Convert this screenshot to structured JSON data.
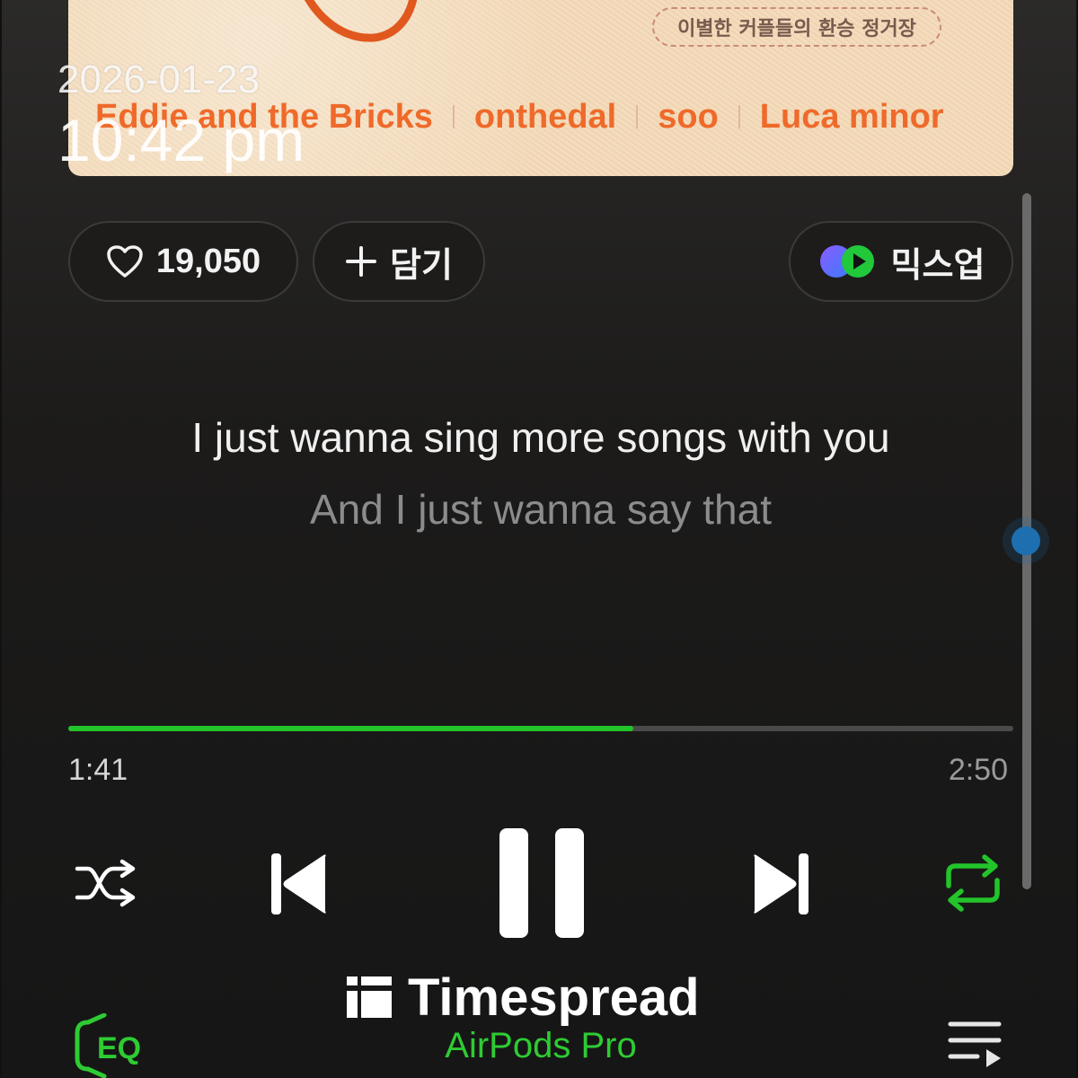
{
  "overlay": {
    "date": "2026-01-23",
    "time": "10:42 pm"
  },
  "album_art": {
    "badge_text": "이별한 커플들의 환승 정거장",
    "artists": [
      "Eddie and the Bricks",
      "onthedal",
      "soo",
      "Luca minor"
    ],
    "artist_color": "#ef6a2a"
  },
  "actions": {
    "like_count": "19,050",
    "add_label": "담기",
    "mixup_label": "믹스업"
  },
  "lyrics": {
    "current": "I just wanna sing more songs with you",
    "next": "And I just wanna say that"
  },
  "playback": {
    "elapsed": "1:41",
    "total": "2:50",
    "progress_fraction": 0.598,
    "accent_color": "#22c42a",
    "repeat_active": true
  },
  "controls": {
    "icons": [
      "shuffle-icon",
      "previous-icon",
      "pause-icon",
      "next-icon",
      "repeat-icon"
    ]
  },
  "footer": {
    "eq_label": "EQ",
    "brand": "Timespread",
    "device": "AirPods Pro"
  }
}
